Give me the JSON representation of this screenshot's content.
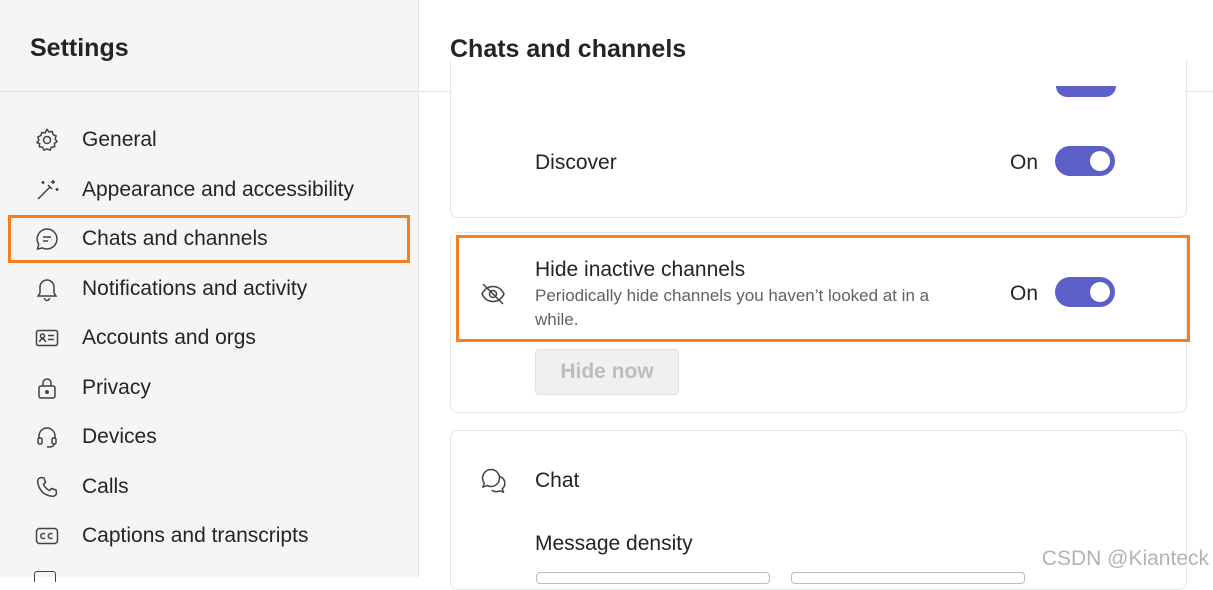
{
  "sidebar": {
    "title": "Settings",
    "items": [
      {
        "label": "General",
        "icon": "gear-icon"
      },
      {
        "label": "Appearance and accessibility",
        "icon": "magic-wand-icon"
      },
      {
        "label": "Chats and channels",
        "icon": "chat-bubble-icon",
        "selected": true
      },
      {
        "label": "Notifications and activity",
        "icon": "bell-icon"
      },
      {
        "label": "Accounts and orgs",
        "icon": "contact-card-icon"
      },
      {
        "label": "Privacy",
        "icon": "lock-icon"
      },
      {
        "label": "Devices",
        "icon": "headset-icon"
      },
      {
        "label": "Calls",
        "icon": "phone-icon"
      },
      {
        "label": "Captions and transcripts",
        "icon": "closed-captions-icon"
      }
    ]
  },
  "main": {
    "title": "Chats and channels",
    "discover": {
      "label": "Discover",
      "state": "On"
    },
    "hide_inactive": {
      "label": "Hide inactive channels",
      "description": "Periodically hide channels you haven’t looked at in a while.",
      "state": "On",
      "button": "Hide now"
    },
    "chat": {
      "label": "Chat",
      "message_density": "Message density"
    }
  },
  "watermark": "CSDN @Kianteck",
  "colors": {
    "accent": "#5b5fc7",
    "highlight": "#f47f1f"
  }
}
